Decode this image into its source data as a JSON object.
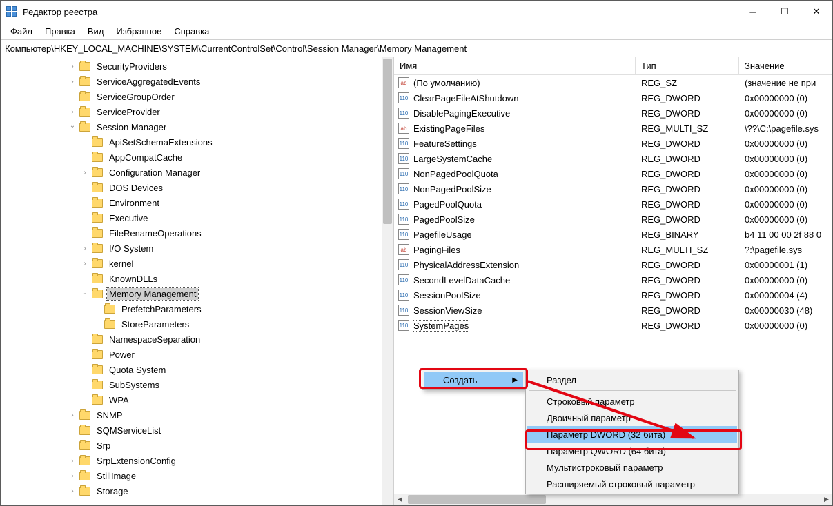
{
  "title": "Редактор реестра",
  "menu": {
    "file": "Файл",
    "edit": "Правка",
    "view": "Вид",
    "fav": "Избранное",
    "help": "Справка"
  },
  "address": "Компьютер\\HKEY_LOCAL_MACHINE\\SYSTEM\\CurrentControlSet\\Control\\Session Manager\\Memory Management",
  "tree": [
    {
      "indent": 5,
      "exp": "closed",
      "label": "SecurityProviders"
    },
    {
      "indent": 5,
      "exp": "closed",
      "label": "ServiceAggregatedEvents"
    },
    {
      "indent": 5,
      "exp": "",
      "label": "ServiceGroupOrder"
    },
    {
      "indent": 5,
      "exp": "closed",
      "label": "ServiceProvider"
    },
    {
      "indent": 5,
      "exp": "open",
      "label": "Session Manager"
    },
    {
      "indent": 6,
      "exp": "",
      "label": "ApiSetSchemaExtensions"
    },
    {
      "indent": 6,
      "exp": "",
      "label": "AppCompatCache"
    },
    {
      "indent": 6,
      "exp": "closed",
      "label": "Configuration Manager"
    },
    {
      "indent": 6,
      "exp": "",
      "label": "DOS Devices"
    },
    {
      "indent": 6,
      "exp": "",
      "label": "Environment"
    },
    {
      "indent": 6,
      "exp": "",
      "label": "Executive"
    },
    {
      "indent": 6,
      "exp": "",
      "label": "FileRenameOperations"
    },
    {
      "indent": 6,
      "exp": "closed",
      "label": "I/O System"
    },
    {
      "indent": 6,
      "exp": "closed",
      "label": "kernel"
    },
    {
      "indent": 6,
      "exp": "",
      "label": "KnownDLLs"
    },
    {
      "indent": 6,
      "exp": "open",
      "label": "Memory Management",
      "selected": true
    },
    {
      "indent": 7,
      "exp": "",
      "label": "PrefetchParameters"
    },
    {
      "indent": 7,
      "exp": "",
      "label": "StoreParameters"
    },
    {
      "indent": 6,
      "exp": "",
      "label": "NamespaceSeparation"
    },
    {
      "indent": 6,
      "exp": "",
      "label": "Power"
    },
    {
      "indent": 6,
      "exp": "",
      "label": "Quota System"
    },
    {
      "indent": 6,
      "exp": "",
      "label": "SubSystems"
    },
    {
      "indent": 6,
      "exp": "",
      "label": "WPA"
    },
    {
      "indent": 5,
      "exp": "closed",
      "label": "SNMP"
    },
    {
      "indent": 5,
      "exp": "",
      "label": "SQMServiceList"
    },
    {
      "indent": 5,
      "exp": "",
      "label": "Srp"
    },
    {
      "indent": 5,
      "exp": "closed",
      "label": "SrpExtensionConfig"
    },
    {
      "indent": 5,
      "exp": "closed",
      "label": "StillImage"
    },
    {
      "indent": 5,
      "exp": "closed",
      "label": "Storage"
    }
  ],
  "cols": {
    "name": "Имя",
    "type": "Тип",
    "value": "Значение"
  },
  "rows": [
    {
      "icon": "str",
      "name": "(По умолчанию)",
      "type": "REG_SZ",
      "value": "(значение не при"
    },
    {
      "icon": "bin",
      "name": "ClearPageFileAtShutdown",
      "type": "REG_DWORD",
      "value": "0x00000000 (0)"
    },
    {
      "icon": "bin",
      "name": "DisablePagingExecutive",
      "type": "REG_DWORD",
      "value": "0x00000000 (0)"
    },
    {
      "icon": "str",
      "name": "ExistingPageFiles",
      "type": "REG_MULTI_SZ",
      "value": "\\??\\C:\\pagefile.sys"
    },
    {
      "icon": "bin",
      "name": "FeatureSettings",
      "type": "REG_DWORD",
      "value": "0x00000000 (0)"
    },
    {
      "icon": "bin",
      "name": "LargeSystemCache",
      "type": "REG_DWORD",
      "value": "0x00000000 (0)"
    },
    {
      "icon": "bin",
      "name": "NonPagedPoolQuota",
      "type": "REG_DWORD",
      "value": "0x00000000 (0)"
    },
    {
      "icon": "bin",
      "name": "NonPagedPoolSize",
      "type": "REG_DWORD",
      "value": "0x00000000 (0)"
    },
    {
      "icon": "bin",
      "name": "PagedPoolQuota",
      "type": "REG_DWORD",
      "value": "0x00000000 (0)"
    },
    {
      "icon": "bin",
      "name": "PagedPoolSize",
      "type": "REG_DWORD",
      "value": "0x00000000 (0)"
    },
    {
      "icon": "bin",
      "name": "PagefileUsage",
      "type": "REG_BINARY",
      "value": "b4 11 00 00 2f 88 0"
    },
    {
      "icon": "str",
      "name": "PagingFiles",
      "type": "REG_MULTI_SZ",
      "value": "?:\\pagefile.sys"
    },
    {
      "icon": "bin",
      "name": "PhysicalAddressExtension",
      "type": "REG_DWORD",
      "value": "0x00000001 (1)"
    },
    {
      "icon": "bin",
      "name": "SecondLevelDataCache",
      "type": "REG_DWORD",
      "value": "0x00000000 (0)"
    },
    {
      "icon": "bin",
      "name": "SessionPoolSize",
      "type": "REG_DWORD",
      "value": "0x00000004 (4)"
    },
    {
      "icon": "bin",
      "name": "SessionViewSize",
      "type": "REG_DWORD",
      "value": "0x00000030 (48)"
    },
    {
      "icon": "bin",
      "name": "SystemPages",
      "type": "REG_DWORD",
      "value": "0x00000000 (0)",
      "focused": true
    }
  ],
  "ctx1": {
    "create": "Создать"
  },
  "ctx2": {
    "section": "Раздел",
    "string": "Строковый параметр",
    "binary": "Двоичный параметр",
    "dword": "Параметр DWORD (32 бита)",
    "qword": "Параметр QWORD (64 бита)",
    "multi": "Мультистроковый параметр",
    "expand": "Расширяемый строковый параметр"
  },
  "icon_text": {
    "str": "ab",
    "bin": "110"
  }
}
